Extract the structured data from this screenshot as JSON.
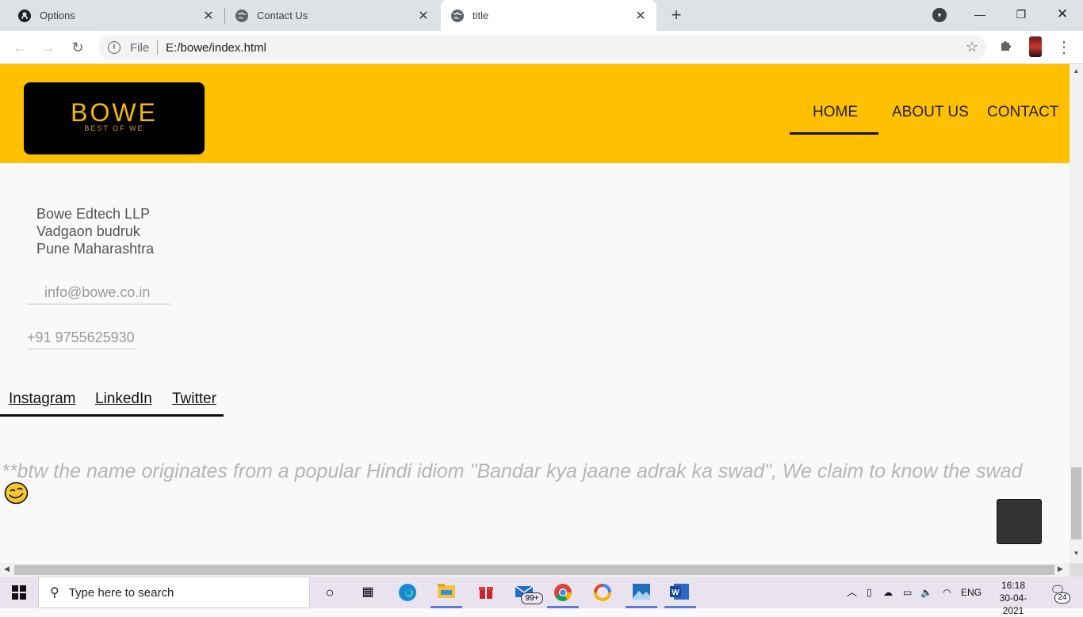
{
  "browser": {
    "tabs": [
      {
        "label": "Options",
        "icon": "github-icon"
      },
      {
        "label": "Contact Us",
        "icon": "globe-icon"
      },
      {
        "label": "title",
        "icon": "globe-icon",
        "active": true
      }
    ],
    "address_scheme": "File",
    "address_url": "E:/bowe/index.html"
  },
  "site": {
    "logo_text": "BOWE",
    "logo_tagline": "BEST OF WE",
    "nav": [
      "HOME",
      "ABOUT US",
      "CONTACT"
    ],
    "active_nav": "HOME",
    "accent_color": "#fec001"
  },
  "contact": {
    "address_lines": [
      "Bowe Edtech LLP",
      "Vadgaon budruk",
      "Pune Maharashtra"
    ],
    "email": "info@bowe.co.in",
    "phone": "+91 9755625930"
  },
  "social": [
    "Instagram",
    "LinkedIn",
    "Twitter"
  ],
  "note": "**btw the name originates from a popular Hindi idiom \"Bandar kya jaane adrak ka swad\", We claim to know the swad",
  "taskbar": {
    "search_placeholder": "Type here to search",
    "mail_badge": "99+",
    "language": "ENG",
    "time": "16:18",
    "date": "30-04-2021",
    "notification_count": "24"
  }
}
